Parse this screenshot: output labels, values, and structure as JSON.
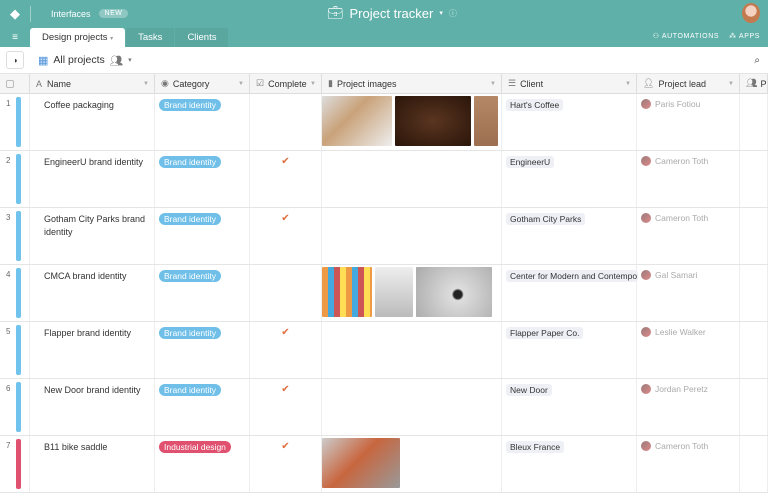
{
  "topbar": {
    "interfaces": "Interfaces",
    "new_badge": "NEW",
    "title": "Project tracker",
    "title_caret": "▾",
    "info": "ⓘ"
  },
  "tabs": [
    {
      "label": "Design projects",
      "caret": "▾"
    },
    {
      "label": "Tasks"
    },
    {
      "label": "Clients"
    }
  ],
  "actions": {
    "automations": "AUTOMATIONS",
    "apps": "APPS"
  },
  "view": {
    "name": "All projects",
    "caret": "▾"
  },
  "columns": [
    "Name",
    "Category",
    "Complete",
    "Project images",
    "Client",
    "Project lead",
    "Pr"
  ],
  "rows": [
    {
      "num": "1",
      "name": "Coffee packaging",
      "category": "Brand identity",
      "complete": "",
      "client": "Hart's Coffee",
      "lead": "Paris Fotiou",
      "bar": "#6fc3ec"
    },
    {
      "num": "2",
      "name": "EngineerU brand identity",
      "category": "Brand identity",
      "complete": "✔",
      "client": "EngineerU",
      "lead": "Cameron Toth",
      "bar": "#6fc3ec"
    },
    {
      "num": "3",
      "name": "Gotham City Parks brand identity",
      "category": "Brand identity",
      "complete": "✔",
      "client": "Gotham City Parks",
      "lead": "Cameron Toth",
      "bar": "#6fc3ec"
    },
    {
      "num": "4",
      "name": "CMCA brand identity",
      "category": "Brand identity",
      "complete": "",
      "client": "Center for Modern and Contempo",
      "lead": "Gal Samari",
      "bar": "#6fc3ec"
    },
    {
      "num": "5",
      "name": "Flapper brand identity",
      "category": "Brand identity",
      "complete": "✔",
      "client": "Flapper Paper Co.",
      "lead": "Leslie Walker",
      "bar": "#6fc3ec"
    },
    {
      "num": "6",
      "name": "New Door brand identity",
      "category": "Brand identity",
      "complete": "✔",
      "client": "New Door",
      "lead": "Jordan Peretz",
      "bar": "#6fc3ec"
    },
    {
      "num": "7",
      "name": "B11 bike saddle",
      "category": "Industrial design",
      "complete": "✔",
      "client": "Bleux France",
      "lead": "Cameron Toth",
      "bar": "#e0506f"
    }
  ],
  "colors": {
    "header": "#5fb0a9",
    "brand_identity": "#6fbfe8",
    "industrial_design": "#e0506f"
  }
}
